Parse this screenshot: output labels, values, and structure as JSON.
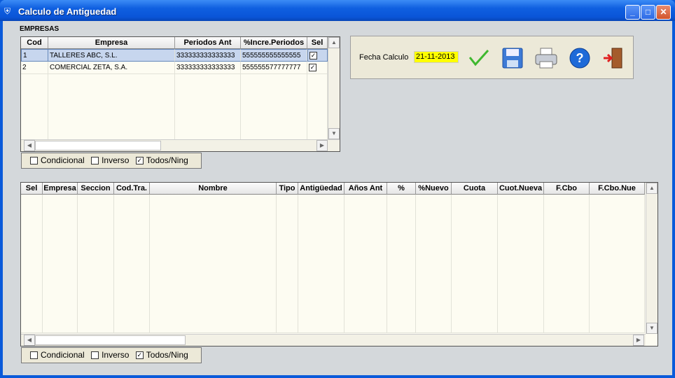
{
  "window": {
    "title": "Calculo de Antiguedad"
  },
  "empresas": {
    "label": "EMPRESAS",
    "columns": [
      "Cod",
      "Empresa",
      "Periodos Ant",
      "%Incre.Periodos",
      "Sel"
    ],
    "rows": [
      {
        "cod": "1",
        "empresa": "TALLERES ABC, S.L.",
        "periodos": "333333333333333",
        "incre": "555555555555555",
        "sel": "✓"
      },
      {
        "cod": "2",
        "empresa": "COMERCIAL ZETA, S.A.",
        "periodos": "333333333333333",
        "incre": "555555577777777",
        "sel": "✓"
      }
    ]
  },
  "options1": {
    "condicional": "Condicional",
    "inverso": "Inverso",
    "todos": "Todos/Ning",
    "todos_check": "✓"
  },
  "options2": {
    "condicional": "Condicional",
    "inverso": "Inverso",
    "todos": "Todos/Ning",
    "todos_check": "✓"
  },
  "panel": {
    "fecha_label": "Fecha Calculo",
    "fecha_value": "21-11-2013"
  },
  "trabajadores": {
    "columns": [
      "Sel",
      "Empresa",
      "Seccion",
      "Cod.Tra.",
      "Nombre",
      "Tipo",
      "Antigüedad",
      "Años Ant",
      "%",
      "%Nuevo",
      "Cuota",
      "Cuot.Nueva",
      "F.Cbo",
      "F.Cbo.Nue"
    ]
  },
  "scroll": {
    "up": "▲",
    "down": "▼",
    "left": "◀",
    "right": "▶"
  }
}
